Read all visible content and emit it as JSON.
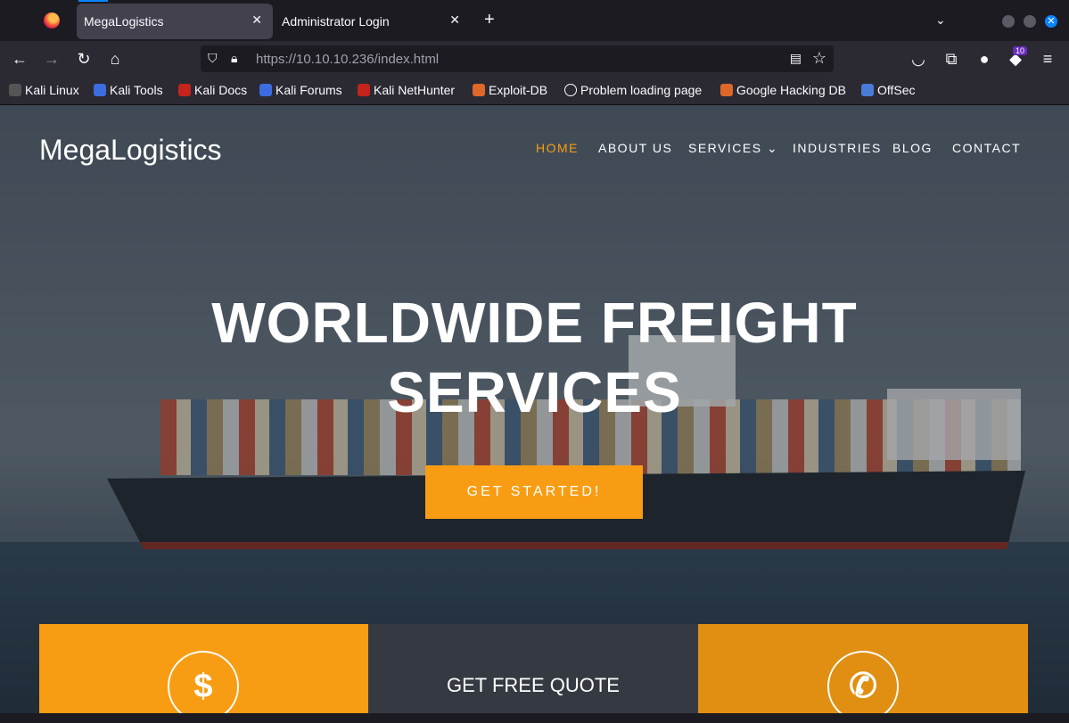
{
  "browser": {
    "tabs": [
      {
        "title": "MegaLogistics",
        "close": "✕"
      },
      {
        "title": "Administrator Login",
        "close": "✕"
      }
    ],
    "new_tab": "+",
    "tab_list": "⌄",
    "url_host": "https://10.10.10.236",
    "url_path": "/index.html",
    "extension_badge": "10"
  },
  "bookmarks": [
    {
      "label": "Kali Linux",
      "color": "#2a2a2a"
    },
    {
      "label": "Kali Tools",
      "color": "#3d6ce0"
    },
    {
      "label": "Kali Docs",
      "color": "#c4241c"
    },
    {
      "label": "Kali Forums",
      "color": "#3d6ce0"
    },
    {
      "label": "Kali NetHunter",
      "color": "#c4241c"
    },
    {
      "label": "Exploit-DB",
      "color": "#e0672a"
    },
    {
      "label": "Problem loading page",
      "color": "#2b2a33"
    },
    {
      "label": "Google Hacking DB",
      "color": "#e0672a"
    },
    {
      "label": "OffSec",
      "color": "#4a7bd8"
    }
  ],
  "site": {
    "brand": "MegaLogistics",
    "menu": [
      "HOME",
      "ABOUT US",
      "SERVICES",
      "INDUSTRIES",
      "BLOG",
      "CONTACT"
    ],
    "hero_line1": "WORLDWIDE FREIGHT",
    "hero_line2": "SERVICES",
    "cta": "GET STARTED!",
    "features": {
      "icon_1": "$",
      "quote": "GET FREE QUOTE",
      "icon_3": "✆"
    },
    "accent": "#f89d13"
  }
}
